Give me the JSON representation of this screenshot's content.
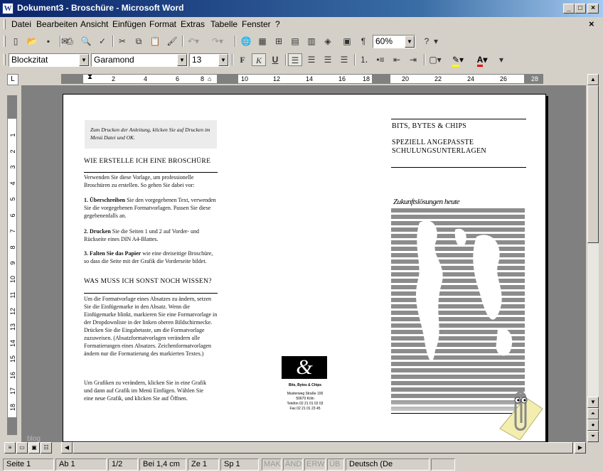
{
  "window": {
    "title": "Dokument3 - Broschüre - Microsoft Word",
    "app_icon_letter": "W"
  },
  "menu": [
    "Datei",
    "Bearbeiten",
    "Ansicht",
    "Einfügen",
    "Format",
    "Extras",
    "Tabelle",
    "Fenster",
    "?"
  ],
  "toolbar": {
    "zoom": "60%"
  },
  "format_bar": {
    "style": "Blockzitat",
    "font": "Garamond",
    "size": "13",
    "bold": "F",
    "italic": "K",
    "underline": "U"
  },
  "ruler": {
    "h_ticks": [
      "2",
      "4",
      "6",
      "8",
      "10",
      "12",
      "14",
      "16",
      "18",
      "20",
      "22",
      "24",
      "26",
      "28"
    ],
    "v_ticks": [
      "1",
      "2",
      "3",
      "4",
      "5",
      "6",
      "7",
      "8",
      "9",
      "10",
      "11",
      "12",
      "13",
      "14",
      "15",
      "16",
      "17",
      "18"
    ]
  },
  "document": {
    "note": "Zum Drucken der Anleitung, klicken Sie auf Drucken im Menü Datei und OK.",
    "h1": "WIE ERSTELLE ICH EINE BROSCHÜRE",
    "p1": "Verwenden Sie diese Vorlage, um professionelle Broschüren zu erstellen. So gehen Sie dabei vor:",
    "step1_bold": "1. Überschreiben",
    "step1": " Sie den vorgegebenen Text, verwenden Sie die vorgegebenen Formatvorlagen. Passen Sie diese gegebenenfalls an.",
    "step2_bold": "2. Drucken",
    "step2": " Sie die Seiten 1 und 2 auf Vorder- und Rückseite eines DIN A4-Blattes.",
    "step3_bold": "3. Falten Sie das Papier",
    "step3": " wie eine dreiseitige Broschüre, so dass die Seite mit der Grafik die Vorderseite bildet.",
    "h2": "WAS MUSS ICH SONST NOCH WISSEN?",
    "p2": "Um die Formatvorlage eines Absatzes zu ändern, setzen Sie die Einfügemarke in den Absatz. Wenn die Einfügemarke blinkt, markieren Sie eine Formatvorlage in der Dropdownliste in der linken oberen Bildschirmecke. Drücken Sie die Eingabetaste, um die Formatvorlage zuzuweisen. (Absatzformatvorlagen verändern alle Formatierungen eines Absatzes. Zeichenformatvorlagen ändern nur die Formatierung des markierten Textes.)",
    "p3": "Um Grafiken zu verändern, klicken Sie in eine Grafik und dann auf Grafik im Menü Einfügen. Wählen Sie eine neue Grafik, und klicken Sie auf Öffnen.",
    "logo_symbol": "&",
    "company": "Bits, Bytes & Chips",
    "address": [
      "Musterweg Straße 100",
      "50670 Köln",
      "Telefon 02 21 01 02 03",
      "Fax 02 21 01 23 45"
    ],
    "right_title": "BITS, BYTES & CHIPS",
    "right_sub": "SPEZIELL ANGEPASSTE SCHULUNGSUNTERLAGEN",
    "right_tagline": "Zukunftslösungen heute"
  },
  "watermark": "blog",
  "status": {
    "page": "Seite  1",
    "section": "Ab  1",
    "pages": "1/2",
    "position": "Bei  1,4 cm",
    "line": "Ze  1",
    "column": "Sp  1",
    "mak": "MAK",
    "and": "ÄND",
    "erw": "ERW",
    "ub": "ÜB",
    "language": "Deutsch (De"
  },
  "colors": {
    "titlebar_start": "#0a246a",
    "workspace": "#808080",
    "chrome": "#d4d0c8"
  }
}
